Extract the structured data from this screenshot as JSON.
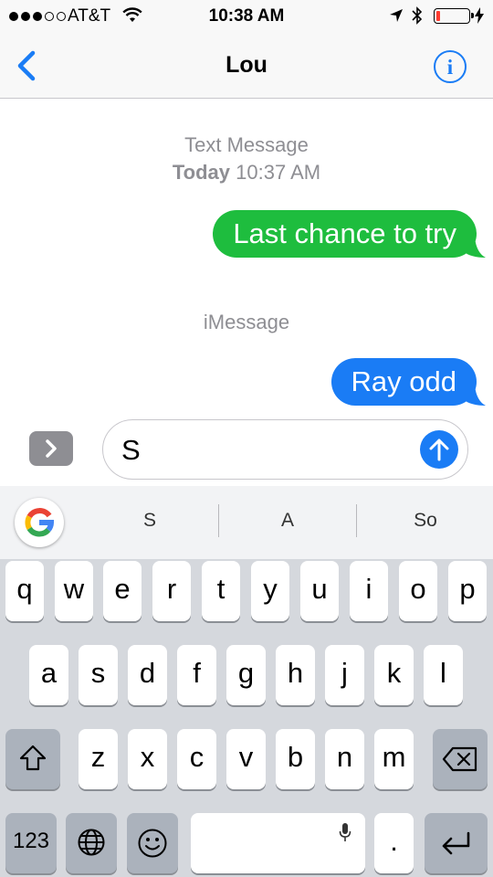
{
  "status_bar": {
    "carrier": "AT&T",
    "time": "10:38 AM",
    "signal_bars": 3,
    "signal_total": 5,
    "battery_level": 0.08
  },
  "nav": {
    "title": "Lou",
    "back_icon": "chevron-left-icon",
    "info_icon": "info-circle-icon"
  },
  "conversation": {
    "sms_header": "Text Message",
    "sms_day": "Today",
    "sms_time": "10:37 AM",
    "message_1": "Last chance to try",
    "imessage_header": "iMessage",
    "message_2": "Ray odd"
  },
  "compose": {
    "text": "S",
    "send_icon": "arrow-up-icon",
    "apps_icon": "chevron-right-icon"
  },
  "keyboard": {
    "suggestions": [
      "S",
      "A",
      "So"
    ],
    "row1": [
      "q",
      "w",
      "e",
      "r",
      "t",
      "y",
      "u",
      "i",
      "o",
      "p"
    ],
    "row2": [
      "a",
      "s",
      "d",
      "f",
      "g",
      "h",
      "j",
      "k",
      "l"
    ],
    "row3": [
      "z",
      "x",
      "c",
      "v",
      "b",
      "n",
      "m"
    ],
    "numbers_label": "123",
    "period_label": "."
  },
  "colors": {
    "sms_bubble": "#1ebd3e",
    "imessage_bubble": "#1a7cf5",
    "ios_blue": "#1a7cf5"
  }
}
